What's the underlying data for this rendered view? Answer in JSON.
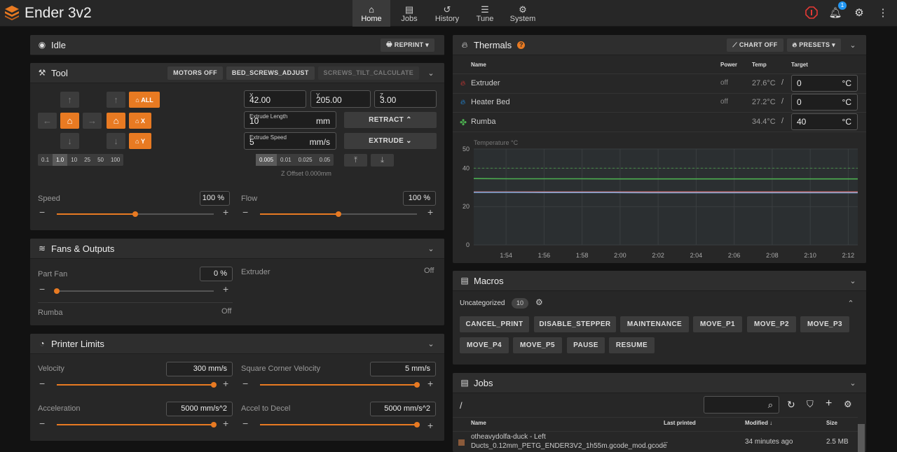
{
  "app": {
    "title": "Ender 3v2"
  },
  "nav": [
    {
      "label": "Home",
      "icon": "home-icon"
    },
    {
      "label": "Jobs",
      "icon": "file-icon"
    },
    {
      "label": "History",
      "icon": "history-icon"
    },
    {
      "label": "Tune",
      "icon": "sliders-icon"
    },
    {
      "label": "System",
      "icon": "gears-icon"
    }
  ],
  "notifications": {
    "count": "1"
  },
  "status": {
    "title": "Idle",
    "reprint_label": "REPRINT"
  },
  "tool": {
    "title": "Tool",
    "motors_off": "MOTORS OFF",
    "bed_screws": "BED_SCREWS_ADJUST",
    "screws_tilt": "SCREWS_TILT_CALCULATE",
    "home_all": "ALL",
    "home_x": "X",
    "home_y": "Y",
    "steps": [
      "0.1",
      "1.0",
      "10",
      "25",
      "50",
      "100"
    ],
    "x_label": "X",
    "x_value": "42.00",
    "y_label": "Y",
    "y_value": "205.00",
    "z_label": "Z",
    "z_value": "3.00",
    "extrude_length_label": "Extrude Length",
    "extrude_length": "10",
    "extrude_length_unit": "mm",
    "extrude_speed_label": "Extrude Speed",
    "extrude_speed": "5",
    "extrude_speed_unit": "mm/s",
    "retract_label": "RETRACT",
    "extrude_label": "EXTRUDE",
    "z_steps": [
      "0.005",
      "0.01",
      "0.025",
      "0.05"
    ],
    "z_offset": "Z Offset 0.000mm",
    "speed_label": "Speed",
    "speed_value": "100 %",
    "speed_level": 0.5,
    "flow_label": "Flow",
    "flow_value": "100 %",
    "flow_level": 0.5
  },
  "fans": {
    "title": "Fans & Outputs",
    "part_fan_label": "Part Fan",
    "part_fan_value": "0 %",
    "part_fan_level": 0,
    "extruder_label": "Extruder",
    "extruder_state": "Off",
    "rumba_label": "Rumba",
    "rumba_state": "Off"
  },
  "limits": {
    "title": "Printer Limits",
    "velocity_label": "Velocity",
    "velocity_value": "300 mm/s",
    "velocity_level": 1,
    "scv_label": "Square Corner Velocity",
    "scv_value": "5 mm/s",
    "scv_level": 1,
    "accel_label": "Acceleration",
    "accel_value": "5000 mm/s^2",
    "accel_level": 1,
    "decel_label": "Accel to Decel",
    "decel_value": "5000 mm/s^2",
    "decel_level": 1
  },
  "thermals": {
    "title": "Thermals",
    "chart_off": "CHART OFF",
    "presets": "PRESETS",
    "headers": {
      "name": "Name",
      "power": "Power",
      "temp": "Temp",
      "target": "Target"
    },
    "rows": [
      {
        "name": "Extruder",
        "power": "off",
        "temp": "27.6°C",
        "target": "0",
        "unit": "°C",
        "color": "#e53935"
      },
      {
        "name": "Heater Bed",
        "power": "off",
        "temp": "27.2°C",
        "target": "0",
        "unit": "°C",
        "color": "#2196f3"
      },
      {
        "name": "Rumba",
        "power": "",
        "temp": "34.4°C",
        "target": "40",
        "unit": "°C",
        "color": "#4caf50"
      }
    ]
  },
  "chart_data": {
    "type": "line",
    "ylabel": "Temperature °C",
    "ylim": [
      0,
      50
    ],
    "yticks": [
      "50",
      "40",
      "20",
      "0"
    ],
    "categories": [
      "1:54",
      "1:56",
      "1:58",
      "2:00",
      "2:02",
      "2:04",
      "2:06",
      "2:08",
      "2:10",
      "2:12"
    ],
    "series": [
      {
        "name": "Extruder",
        "color": "#e57373",
        "values": [
          27.6,
          27.6,
          27.6,
          27.6,
          27.6,
          27.6,
          27.6,
          27.6,
          27.6,
          27.6,
          27.6,
          27.6
        ]
      },
      {
        "name": "Heater Bed",
        "color": "#7fa3d1",
        "values": [
          27.4,
          27.4,
          27.3,
          27.3,
          27.3,
          27.2,
          27.2,
          27.2,
          27.2,
          27.2,
          27.2,
          27.2
        ]
      },
      {
        "name": "Rumba",
        "color": "#4caf50",
        "values": [
          34.6,
          34.5,
          34.5,
          34.5,
          34.4,
          34.4,
          34.4,
          34.4,
          34.4,
          34.4,
          34.4,
          34.4
        ]
      }
    ],
    "target_line": 40
  },
  "macros": {
    "title": "Macros",
    "group": "Uncategorized",
    "count": "10",
    "items": [
      "CANCEL_PRINT",
      "DISABLE_STEPPER",
      "MAINTENANCE",
      "MOVE_P1",
      "MOVE_P2",
      "MOVE_P3",
      "MOVE_P4",
      "MOVE_P5",
      "PAUSE",
      "RESUME"
    ]
  },
  "jobs": {
    "title": "Jobs",
    "path": "/",
    "headers": {
      "name": "Name",
      "last": "Last printed",
      "modified": "Modified",
      "size": "Size"
    },
    "rows": [
      {
        "name_line1": "otheavydolfa-duck - Left",
        "name_line2": "Ducts_0.12mm_PETG_ENDER3V2_1h55m.gcode_mod.gcode",
        "last": "--",
        "modified": "34 minutes ago",
        "size": "2.5 MB"
      }
    ]
  }
}
